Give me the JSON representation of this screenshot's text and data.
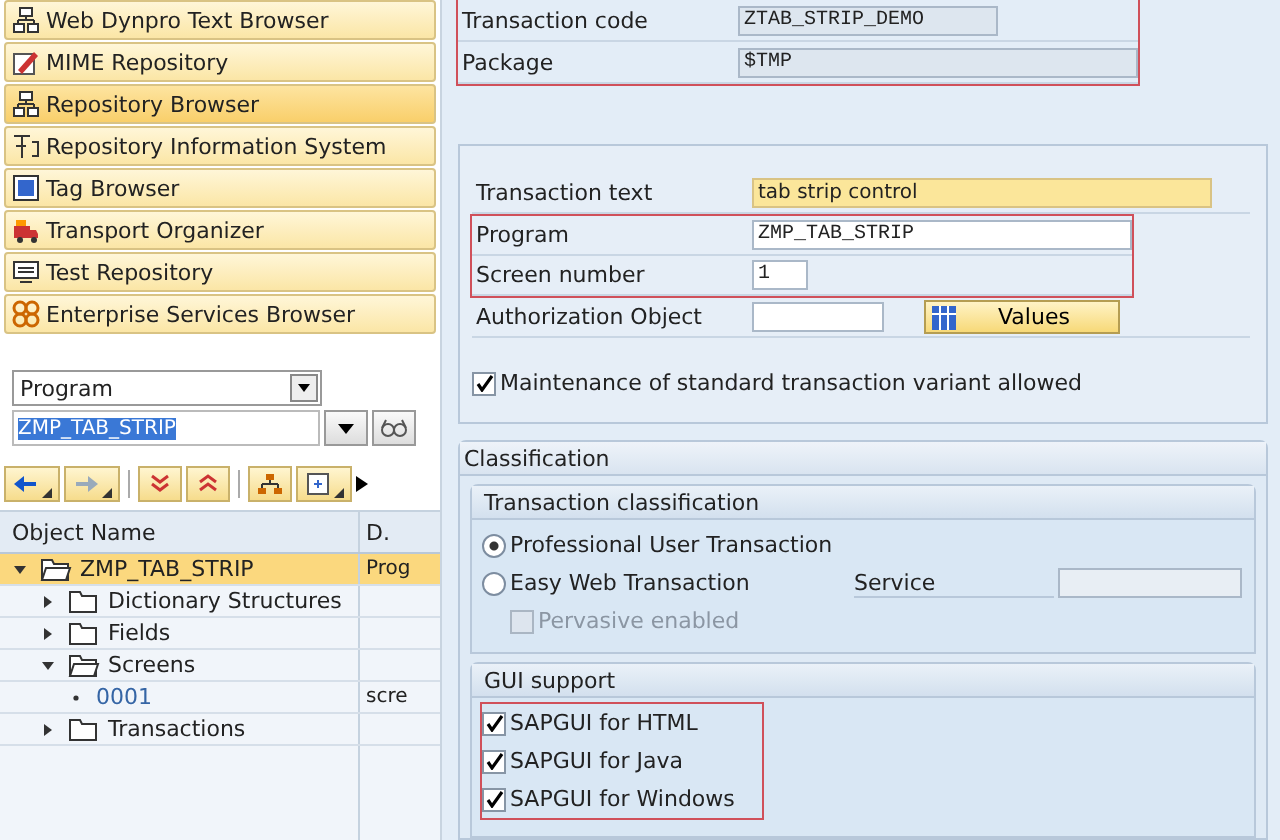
{
  "nav": {
    "items": [
      {
        "label": "Web Dynpro Text Browser",
        "selected": false
      },
      {
        "label": "MIME Repository",
        "selected": false
      },
      {
        "label": "Repository Browser",
        "selected": true
      },
      {
        "label": "Repository Information System",
        "selected": false
      },
      {
        "label": "Tag Browser",
        "selected": false
      },
      {
        "label": "Transport Organizer",
        "selected": false
      },
      {
        "label": "Test Repository",
        "selected": false
      },
      {
        "label": "Enterprise Services Browser",
        "selected": false
      }
    ]
  },
  "object_selector": {
    "type": "Program",
    "name": "ZMP_TAB_STRIP"
  },
  "tree": {
    "columns": [
      "Object Name",
      "D."
    ],
    "rows": [
      {
        "label": "ZMP_TAB_STRIP",
        "column_2": "Prog",
        "expanded": true,
        "selected": true,
        "children": [
          {
            "label": "Dictionary Structures",
            "expanded": false,
            "selected": false
          },
          {
            "label": "Fields",
            "expanded": false,
            "selected": false
          },
          {
            "label": "Screens",
            "expanded": true,
            "selected": false,
            "children": [
              {
                "label": "0001",
                "column_2": "scre",
                "selected": false
              }
            ]
          },
          {
            "label": "Transactions",
            "expanded": false,
            "selected": false
          }
        ]
      }
    ]
  },
  "header": {
    "highlighted": true,
    "fields": [
      {
        "label": "Transaction code",
        "value": "ZTAB_STRIP_DEMO"
      },
      {
        "label": "Package",
        "value": "$TMP"
      }
    ]
  },
  "details": {
    "transaction_text": {
      "label": "Transaction text",
      "value": "tab strip control"
    },
    "program_group": {
      "highlighted": true,
      "fields": [
        {
          "label": "Program",
          "value": "ZMP_TAB_STRIP"
        },
        {
          "label": "Screen number",
          "value": "1"
        }
      ]
    },
    "authorization": {
      "label": "Authorization Object",
      "button": "Values"
    },
    "variant": {
      "label": "Maintenance of standard transaction variant allowed",
      "checked": true
    }
  },
  "classification": {
    "title": "Classification",
    "transaction_classification": {
      "title": "Transaction classification",
      "options": [
        {
          "label": "Professional User Transaction",
          "selected": true
        },
        {
          "label": "Easy Web Transaction",
          "selected": false
        }
      ],
      "service_label": "Service",
      "pervasive": {
        "label": "Pervasive enabled",
        "checked": false,
        "disabled": true
      }
    },
    "gui_support": {
      "title": "GUI support",
      "highlighted": true,
      "options": [
        {
          "label": "SAPGUI for HTML",
          "checked": true
        },
        {
          "label": "SAPGUI for Java",
          "checked": true
        },
        {
          "label": "SAPGUI for Windows",
          "checked": true
        }
      ]
    }
  }
}
